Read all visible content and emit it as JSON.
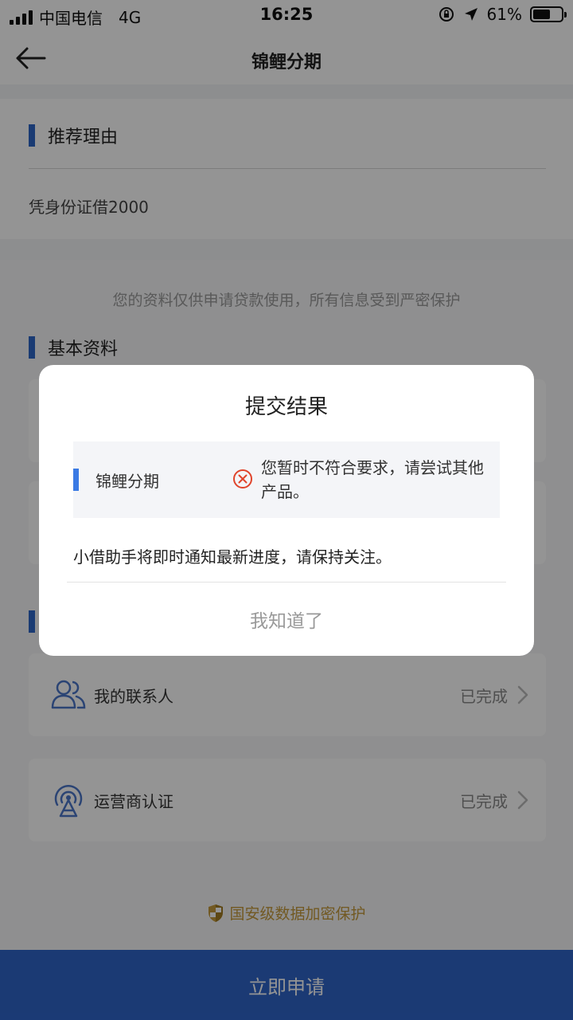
{
  "status_bar": {
    "carrier": "中国电信",
    "network": "4G",
    "time": "16:25",
    "battery_percent": "61%",
    "battery_level": 0.61
  },
  "nav": {
    "title": "锦鲤分期",
    "back_icon": "arrow-left-icon"
  },
  "reason_card": {
    "title": "推荐理由",
    "text": "凭身份证借2000"
  },
  "info": {
    "privacy_note": "您的资料仅供申请贷款使用，所有信息受到严密保护",
    "basic_title": "基本资料",
    "rows": [
      {
        "label": "我的联系人",
        "status": "已完成",
        "icon": "contacts-icon"
      },
      {
        "label": "运营商认证",
        "status": "已完成",
        "icon": "signal-tower-icon"
      }
    ],
    "secure_note": "国安级数据加密保护",
    "secure_icon": "shield-icon"
  },
  "apply_button": "立即申请",
  "modal": {
    "title": "提交结果",
    "result": {
      "name": "锦鲤分期",
      "message": "您暂时不符合要求，请尝试其他产品。",
      "icon": "error-circle-icon"
    },
    "notice": "小借助手将即时通知最新进度，请保持关注。",
    "confirm": "我知道了"
  },
  "colors": {
    "accent": "#2f64c9",
    "error": "#e0442b",
    "gold": "#c49a3c"
  }
}
